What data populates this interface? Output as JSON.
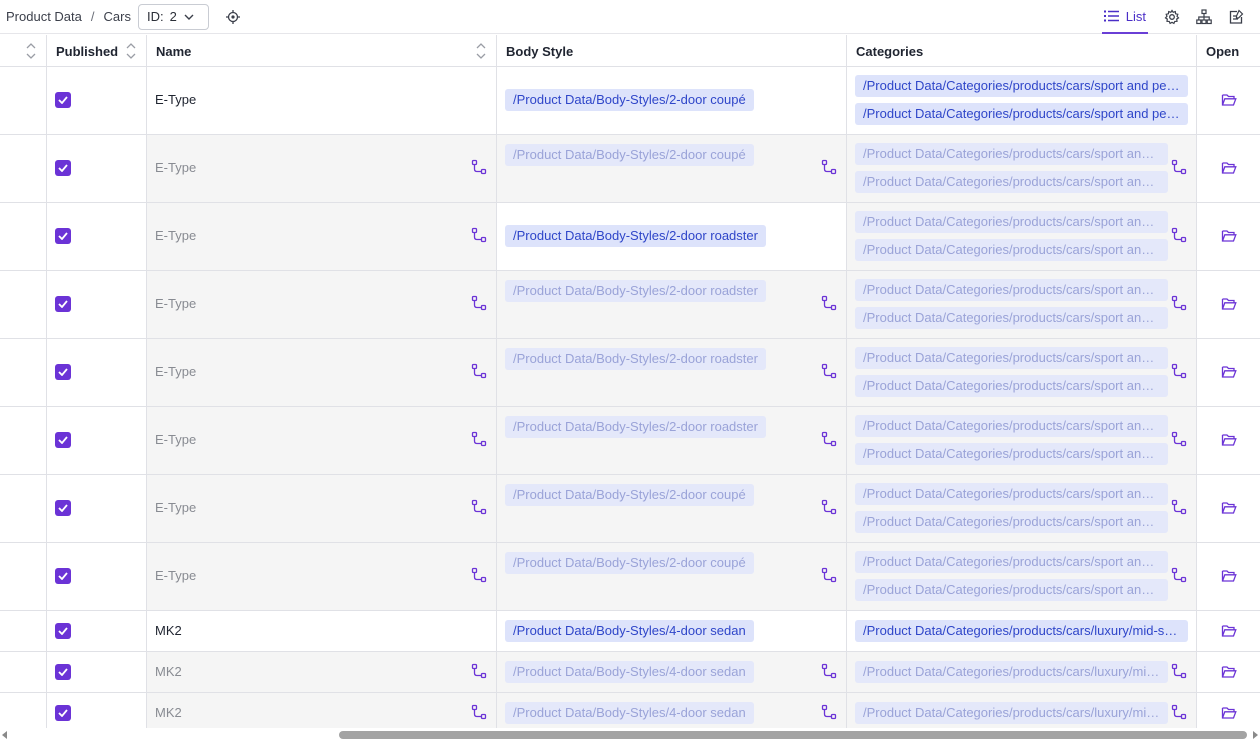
{
  "breadcrumb": {
    "root": "Product Data",
    "separator": "/",
    "current": "Cars"
  },
  "id_selector": {
    "label": "ID:",
    "value": "2"
  },
  "toolbar": {
    "list_label": "List"
  },
  "columns": {
    "published": "Published",
    "name": "Name",
    "body_style": "Body Style",
    "categories": "Categories",
    "open": "Open"
  },
  "colors": {
    "accent": "#6b33d6",
    "tag_bg": "#dde3fb",
    "tag_text": "#2f46c9",
    "inherited_tag_text": "#9aa3d8"
  },
  "rows": [
    {
      "published": true,
      "inherited": false,
      "name": "E-Type",
      "body_style": "/Product Data/Body-Styles/2-door coupé",
      "categories": [
        "/Product Data/Categories/products/cars/sport and perfor...",
        "/Product Data/Categories/products/cars/sport and perfor..."
      ]
    },
    {
      "published": true,
      "inherited": true,
      "name": "E-Type",
      "body_style": "/Product Data/Body-Styles/2-door coupé",
      "categories": [
        "/Product Data/Categories/products/cars/sport and per...",
        "/Product Data/Categories/products/cars/sport and per..."
      ]
    },
    {
      "published": true,
      "inherited": true,
      "body_inherited": false,
      "name": "E-Type",
      "body_style": "/Product Data/Body-Styles/2-door roadster",
      "categories": [
        "/Product Data/Categories/products/cars/sport and per...",
        "/Product Data/Categories/products/cars/sport and per..."
      ]
    },
    {
      "published": true,
      "inherited": true,
      "name": "E-Type",
      "body_style": "/Product Data/Body-Styles/2-door roadster",
      "categories": [
        "/Product Data/Categories/products/cars/sport and per...",
        "/Product Data/Categories/products/cars/sport and per..."
      ]
    },
    {
      "published": true,
      "inherited": true,
      "name": "E-Type",
      "body_style": "/Product Data/Body-Styles/2-door roadster",
      "categories": [
        "/Product Data/Categories/products/cars/sport and per...",
        "/Product Data/Categories/products/cars/sport and per..."
      ]
    },
    {
      "published": true,
      "inherited": true,
      "name": "E-Type",
      "body_style": "/Product Data/Body-Styles/2-door roadster",
      "categories": [
        "/Product Data/Categories/products/cars/sport and per...",
        "/Product Data/Categories/products/cars/sport and per..."
      ]
    },
    {
      "published": true,
      "inherited": true,
      "name": "E-Type",
      "body_style": "/Product Data/Body-Styles/2-door coupé",
      "categories": [
        "/Product Data/Categories/products/cars/sport and per...",
        "/Product Data/Categories/products/cars/sport and per..."
      ]
    },
    {
      "published": true,
      "inherited": true,
      "name": "E-Type",
      "body_style": "/Product Data/Body-Styles/2-door coupé",
      "categories": [
        "/Product Data/Categories/products/cars/sport and per...",
        "/Product Data/Categories/products/cars/sport and per..."
      ]
    },
    {
      "published": true,
      "inherited": false,
      "name": "MK2",
      "body_style": "/Product Data/Body-Styles/4-door sedan",
      "categories": [
        "/Product Data/Categories/products/cars/luxury/mid-size l..."
      ]
    },
    {
      "published": true,
      "inherited": true,
      "name": "MK2",
      "body_style": "/Product Data/Body-Styles/4-door sedan",
      "categories": [
        "/Product Data/Categories/products/cars/luxury/mid-si..."
      ]
    },
    {
      "published": true,
      "inherited": true,
      "name": "MK2",
      "body_style": "/Product Data/Body-Styles/4-door sedan",
      "categories": [
        "/Product Data/Categories/products/cars/luxury/mid-si..."
      ]
    }
  ]
}
